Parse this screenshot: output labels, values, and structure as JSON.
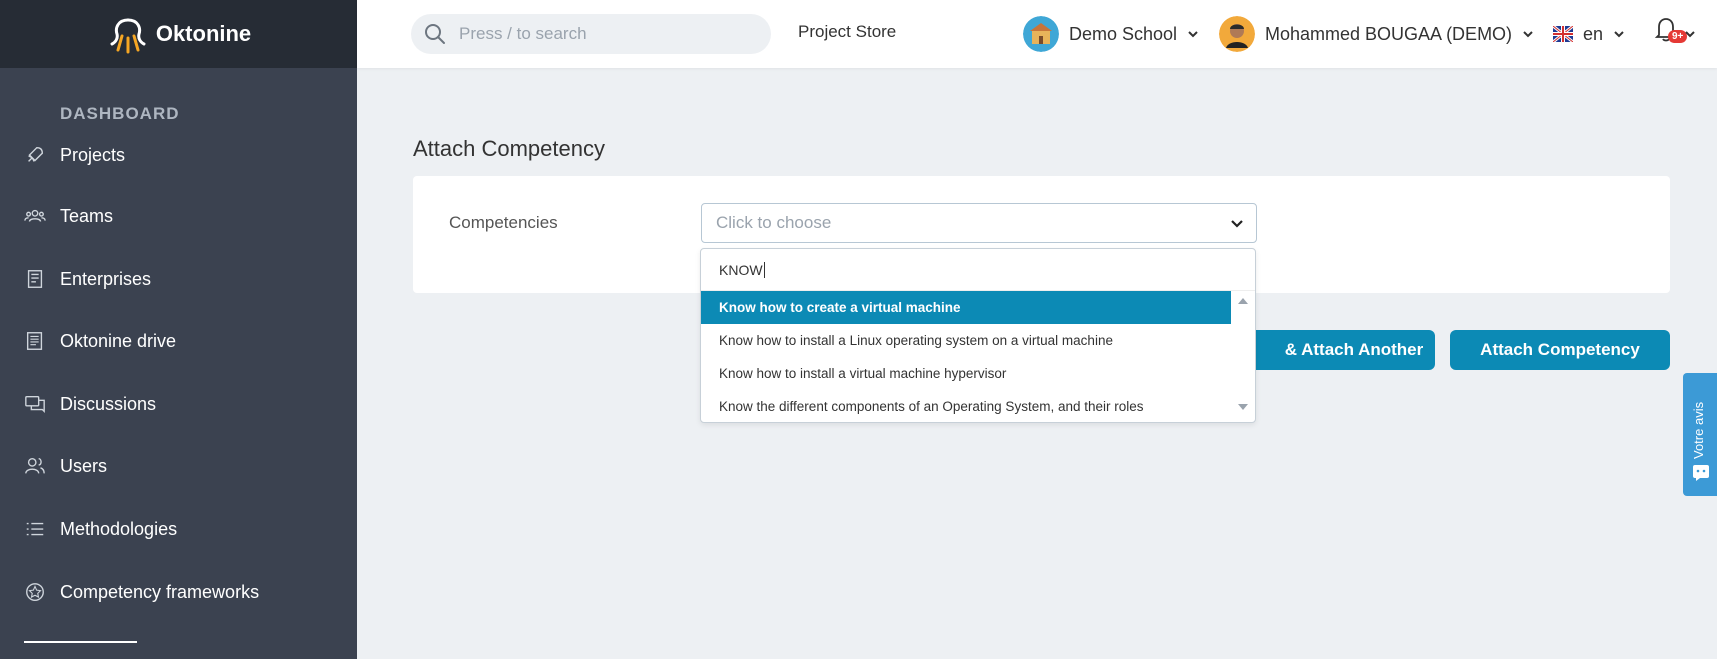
{
  "brand": {
    "name": "Oktonine"
  },
  "sidebar": {
    "heading": "DASHBOARD",
    "items": [
      {
        "label": "Projects",
        "icon": "rocket-icon"
      },
      {
        "label": "Teams",
        "icon": "team-icon"
      },
      {
        "label": "Enterprises",
        "icon": "building-icon"
      },
      {
        "label": "Oktonine drive",
        "icon": "drive-icon"
      },
      {
        "label": "Discussions",
        "icon": "chat-icon"
      },
      {
        "label": "Users",
        "icon": "users-icon"
      },
      {
        "label": "Methodologies",
        "icon": "list-icon"
      },
      {
        "label": "Competency frameworks",
        "icon": "badge-icon"
      }
    ]
  },
  "topbar": {
    "search_placeholder": "Press / to search",
    "project_store": "Project Store",
    "school": "Demo School",
    "user": "Mohammed BOUGAA (DEMO)",
    "language": "en",
    "notif_badge": "9+"
  },
  "main": {
    "title": "Attach Competency",
    "field_label": "Competencies",
    "select_placeholder": "Click to choose",
    "buttons": {
      "attach_another": "& Attach Another",
      "attach": "Attach Competency"
    }
  },
  "dropdown": {
    "search_value": "KNOW",
    "options": [
      "Know how to create a virtual machine",
      "Know how to install a Linux operating system on a virtual machine",
      "Know how to install a virtual machine hypervisor",
      "Know the different components of an Operating System, and their roles"
    ],
    "active_index": 0
  },
  "feedback": {
    "label": "Votre avis"
  },
  "colors": {
    "accent": "#0c8ab5",
    "sidebar": "#3b4250",
    "sidebar_header": "#262c35"
  }
}
